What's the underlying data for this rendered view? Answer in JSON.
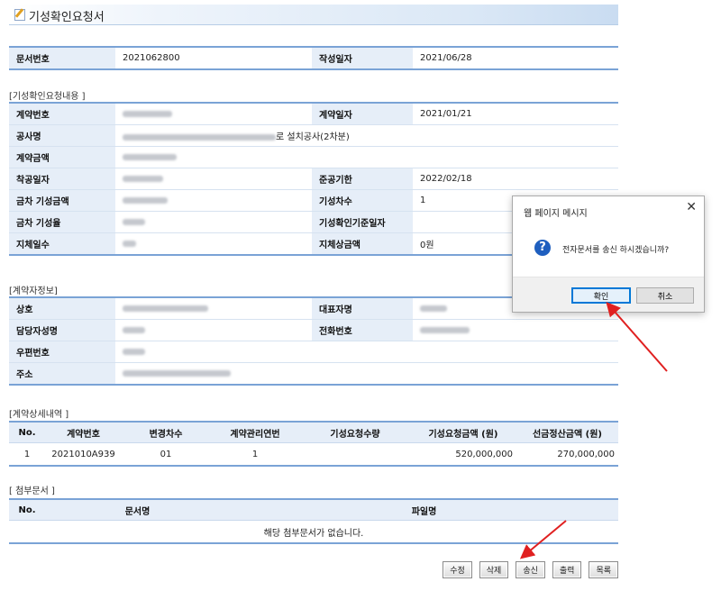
{
  "title": "기성확인요청서",
  "doc": {
    "no_label": "문서번호",
    "no_value": "2021062800",
    "date_label": "작성일자",
    "date_value": "2021/06/28"
  },
  "request": {
    "section": "[기성확인요청내용 ]",
    "contract_no_label": "계약번호",
    "contract_date_label": "계약일자",
    "contract_date_value": "2021/01/21",
    "project_label": "공사명",
    "project_suffix": "로 설치공사(2차분)",
    "amount_label": "계약금액",
    "start_label": "착공일자",
    "deadline_label": "준공기한",
    "deadline_value": "2022/02/18",
    "this_amount_label": "금차 기성금액",
    "count_label": "기성차수",
    "count_value": "1",
    "this_rate_label": "금차 기성율",
    "basis_date_label": "기성확인기준일자",
    "delay_days_label": "지체일수",
    "delay_amount_label": "지체상금액",
    "delay_amount_value": "0원"
  },
  "contractor": {
    "section": "[계약자정보]",
    "company_label": "상호",
    "ceo_label": "대표자명",
    "manager_label": "담당자성명",
    "phone_label": "전화번호",
    "zip_label": "우편번호",
    "address_label": "주소"
  },
  "detail": {
    "section": "[계약상세내역 ]",
    "headers": [
      "No.",
      "계약번호",
      "변경차수",
      "계약관리연번",
      "기성요청수량",
      "기성요청금액 (원)",
      "선금정산금액 (원)"
    ],
    "row": [
      "1",
      "2021010A939",
      "01",
      "1",
      "",
      "520,000,000",
      "270,000,000"
    ]
  },
  "attach": {
    "section": "[ 첨부문서 ]",
    "headers": [
      "No.",
      "문서명",
      "파일명"
    ],
    "empty": "해당 첨부문서가 없습니다."
  },
  "buttons": {
    "edit": "수정",
    "delete": "삭제",
    "send": "송신",
    "print": "출력",
    "list": "목록"
  },
  "dialog": {
    "title": "웹 페이지 메시지",
    "close": "✕",
    "message": "전자문서를 송신 하시겠습니까?",
    "ok": "확인",
    "cancel": "취소"
  },
  "colors": {
    "header_bg": "#e6eef8",
    "border_blue": "#7aa3d6",
    "arrow": "#e02020"
  }
}
